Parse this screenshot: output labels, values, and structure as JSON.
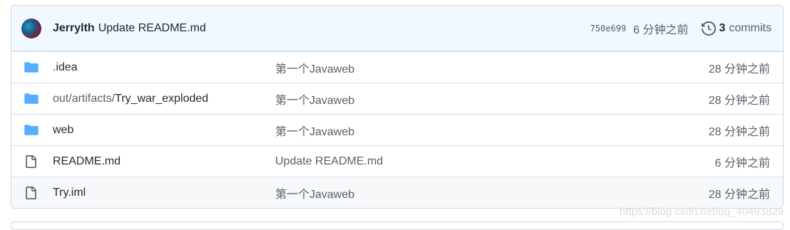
{
  "latest_commit": {
    "author": "Jerrylth",
    "message": "Update README.md",
    "sha": "750e699",
    "age": "6 分钟之前",
    "commits_count": "3",
    "commits_label": "commits"
  },
  "files": [
    {
      "type": "folder",
      "prefix": "",
      "name": ".idea",
      "message": "第一个Javaweb",
      "age": "28 分钟之前"
    },
    {
      "type": "folder",
      "prefix": "out/artifacts/",
      "name": "Try_war_exploded",
      "message": "第一个Javaweb",
      "age": "28 分钟之前"
    },
    {
      "type": "folder",
      "prefix": "",
      "name": "web",
      "message": "第一个Javaweb",
      "age": "28 分钟之前"
    },
    {
      "type": "file",
      "prefix": "",
      "name": "README.md",
      "message": "Update README.md",
      "age": "6 分钟之前"
    },
    {
      "type": "file",
      "prefix": "",
      "name": "Try.iml",
      "message": "第一个Javaweb",
      "age": "28 分钟之前"
    }
  ],
  "watermark": "https://blog.csdn.net/qq_40493829",
  "colors": {
    "folder": "#54aeff",
    "header_bg": "#f1f8ff"
  }
}
